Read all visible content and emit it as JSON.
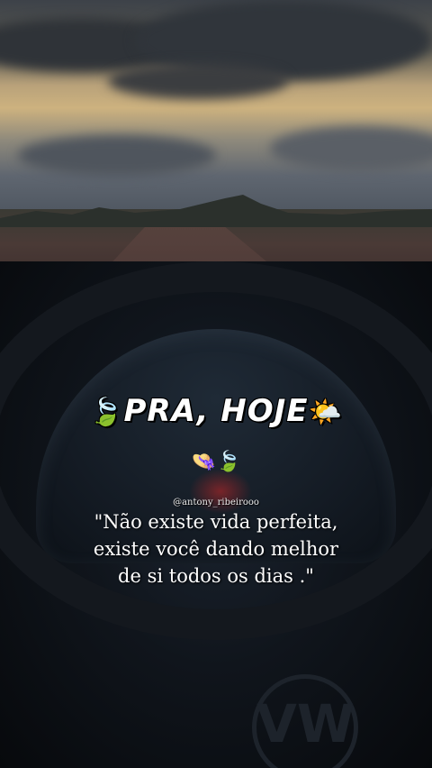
{
  "title": {
    "text": "PRA, HOJE",
    "leading_emoji": "🍃",
    "trailing_emoji": "🌤️"
  },
  "emoji_row": "👒🍃",
  "handle": "@antony_ribeirooo",
  "quote": {
    "line1": "\"Não existe vida perfeita,",
    "line2": "existe você dando melhor",
    "line3": "de si todos os dias .\""
  },
  "logo": "VW"
}
